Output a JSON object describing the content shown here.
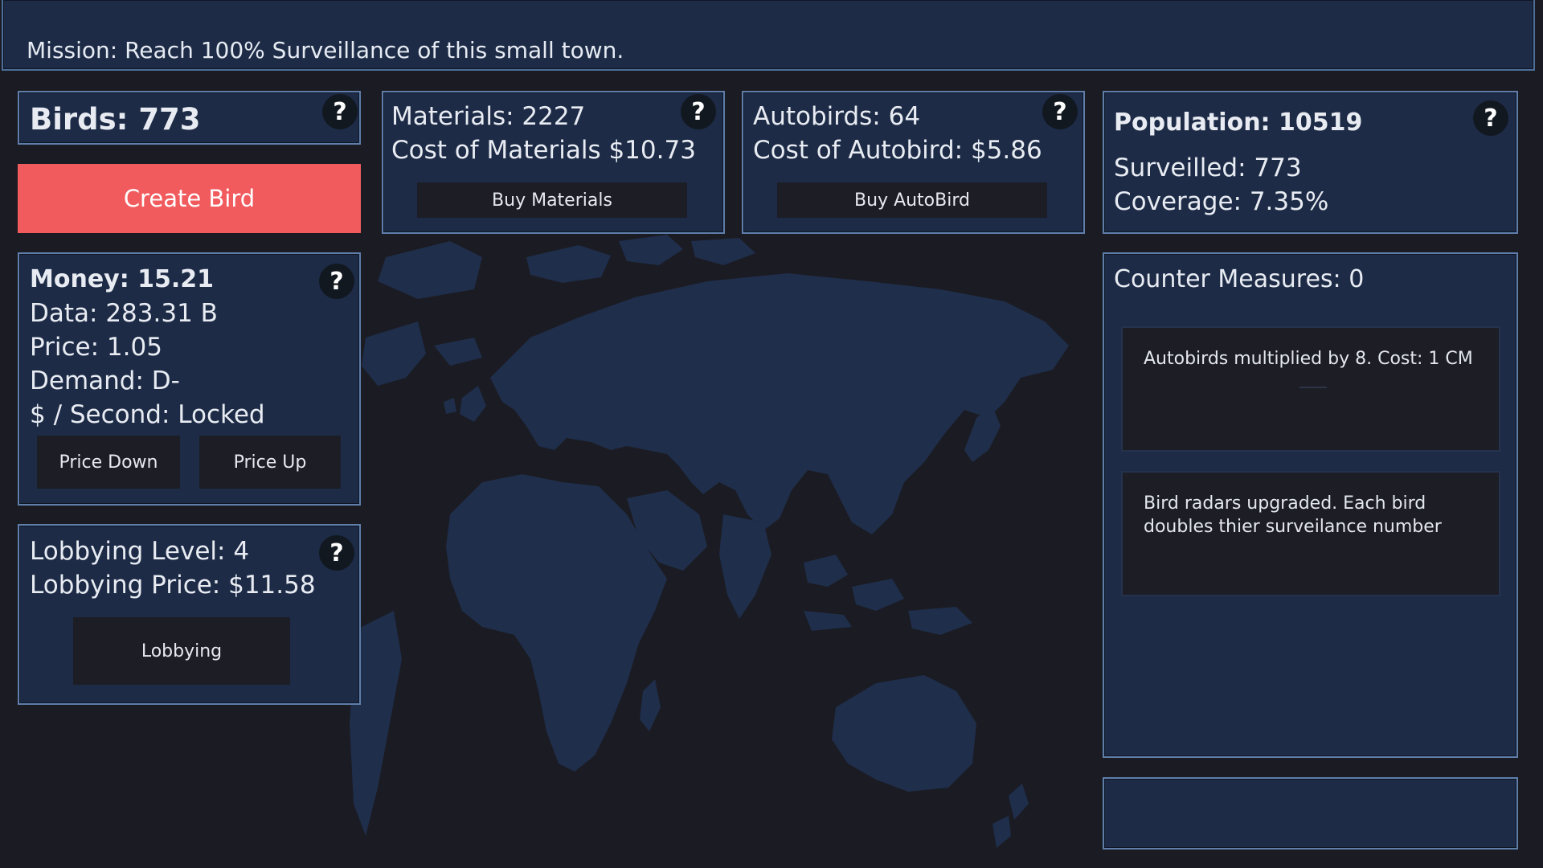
{
  "mission": {
    "text": "Mission: Reach 100% Surveillance of this small town."
  },
  "birds": {
    "label": "Birds: 773",
    "help": "?"
  },
  "create_bird": {
    "label": "Create Bird"
  },
  "materials": {
    "count": "Materials: 2227",
    "cost": "Cost of Materials $10.73",
    "button": "Buy Materials",
    "help": "?"
  },
  "autobirds": {
    "count": "Autobirds: 64",
    "cost": "Cost of Autobird: $5.86",
    "button": "Buy AutoBird",
    "help": "?"
  },
  "population": {
    "total": "Population: 10519",
    "surveilled": "Surveilled: 773",
    "coverage": "Coverage: 7.35%",
    "help": "?"
  },
  "money": {
    "money": "Money: 15.21",
    "data": "Data: 283.31 B",
    "price": "Price: 1.05",
    "demand": "Demand: D-",
    "per_second": "$ / Second: Locked",
    "price_down": "Price Down",
    "price_up": "Price Up",
    "help": "?"
  },
  "lobbying": {
    "level": "Lobbying Level: 4",
    "price": "Lobbying Price: $11.58",
    "button": "Lobbying",
    "help": "?"
  },
  "counter_measures": {
    "title": "Counter Measures: 0",
    "items": [
      {
        "text": "Autobirds multiplied by 8. Cost: 1 CM"
      },
      {
        "text": "Bird radars upgraded.  Each bird doubles thier surveilance number"
      }
    ]
  },
  "colors": {
    "background": "#1b1c23",
    "panel": "#1d2b47",
    "panel_border": "#5f7eaa",
    "map_land": "#1f2e4b",
    "accent_create": "#f25b5e",
    "button_dark": "#1c1d25"
  },
  "icons": {
    "help": "question-mark-icon",
    "map": "world-map"
  }
}
